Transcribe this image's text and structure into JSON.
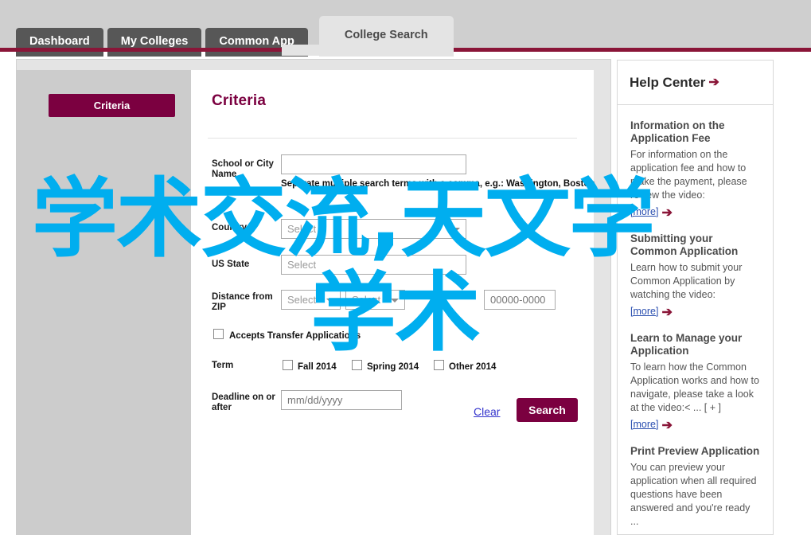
{
  "tabs": [
    {
      "label": "Dashboard",
      "active": false
    },
    {
      "label": "My Colleges",
      "active": false
    },
    {
      "label": "Common App",
      "active": false
    },
    {
      "label": "College Search",
      "active": true
    }
  ],
  "sidebar": {
    "criteria_button": "Criteria"
  },
  "content": {
    "title": "Criteria",
    "fields": {
      "school_label": "School or City Name",
      "school_value": "",
      "school_hint": "Separate multiple search terms with a comma, e.g.: Washington, Boston",
      "country_label": "Country",
      "country_value": "Select",
      "state_label": "US State",
      "state_value": "Select",
      "distance_label": "Distance from ZIP",
      "distance_value": "Select",
      "distance_unit_value": "Select",
      "zip_placeholder": "00000-0000",
      "transfer_label": "Accepts Transfer Applications",
      "term_label": "Term",
      "terms": [
        "Fall 2014",
        "Spring 2014",
        "Other 2014"
      ],
      "deadline_label": "Deadline on or after",
      "deadline_placeholder": "mm/dd/yyyy"
    },
    "actions": {
      "clear": "Clear",
      "search": "Search"
    }
  },
  "help": {
    "title": "Help Center",
    "title_icon": "arrow-right-icon",
    "more_label": "[more]",
    "items": [
      {
        "heading": "Information on the Application Fee",
        "body": "For information on the application fee and how to make the payment, please review the video:"
      },
      {
        "heading": "Submitting your Common Application",
        "body": "Learn how to submit your Common Application by watching the video:"
      },
      {
        "heading": "Learn to Manage your Application",
        "body": "To learn how the Common Application works and how to navigate, please take a look at the video:< ... [ + ]"
      },
      {
        "heading": "Print Preview Application",
        "body": "You can preview your application when all required questions have been answered and you're ready ..."
      }
    ]
  },
  "watermark": {
    "line1": "学术交流,天文学",
    "line2": "学术",
    "color": "#00aeef"
  },
  "colors": {
    "brand_maroon": "#7b0040",
    "bar_maroon": "#8a1538",
    "tab_grey": "#575757",
    "page_grey": "#cfcfcf",
    "sidebar_grey": "#cccccc",
    "link_blue": "#3333cc"
  }
}
